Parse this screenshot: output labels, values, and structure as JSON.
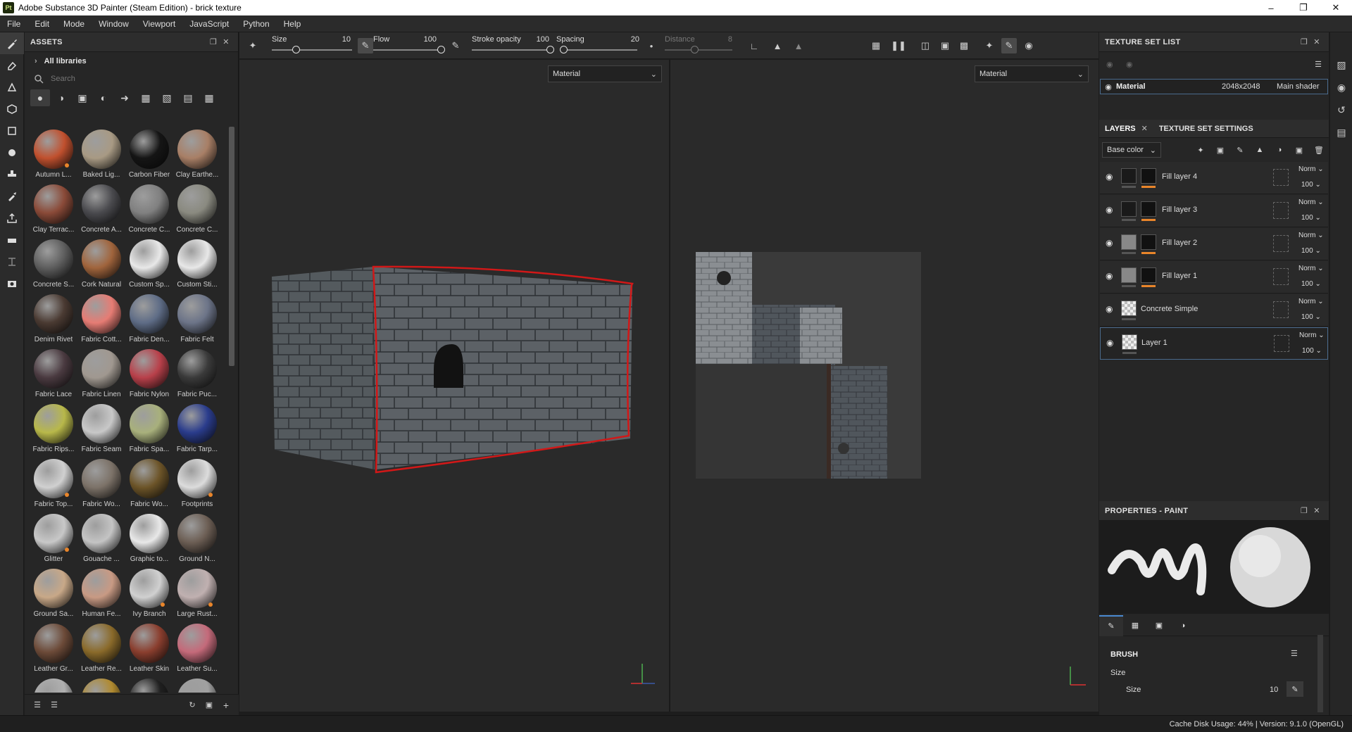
{
  "window": {
    "title": "Adobe Substance 3D Painter (Steam Edition) - brick texture",
    "app_icon": "Pt"
  },
  "menu": [
    "File",
    "Edit",
    "Mode",
    "Window",
    "Viewport",
    "JavaScript",
    "Python",
    "Help"
  ],
  "assets": {
    "title": "ASSETS",
    "library": "All libraries",
    "search_placeholder": "Search",
    "items": [
      {
        "label": "Autumn L...",
        "color": "#c0502e",
        "badge": true
      },
      {
        "label": "Baked Lig...",
        "color": "#a89a84",
        "badge": false
      },
      {
        "label": "Carbon Fiber",
        "color": "#151515",
        "badge": false
      },
      {
        "label": "Clay Earthe...",
        "color": "#a87f66",
        "badge": false
      },
      {
        "label": "Clay Terrac...",
        "color": "#8a4a38",
        "badge": false
      },
      {
        "label": "Concrete A...",
        "color": "#4a4a4e",
        "badge": false
      },
      {
        "label": "Concrete C...",
        "color": "#808080",
        "badge": false
      },
      {
        "label": "Concrete C...",
        "color": "#8a8a80",
        "badge": false
      },
      {
        "label": "Concrete S...",
        "color": "#5e5e5e",
        "badge": false
      },
      {
        "label": "Cork Natural",
        "color": "#a0643c",
        "badge": false
      },
      {
        "label": "Custom Sp...",
        "color": "#e8e8e8",
        "badge": false
      },
      {
        "label": "Custom Sti...",
        "color": "#e8e8e8",
        "badge": false
      },
      {
        "label": "Denim Rivet",
        "color": "#4a3a32",
        "badge": false
      },
      {
        "label": "Fabric Cott...",
        "color": "#e67c74",
        "badge": false
      },
      {
        "label": "Fabric Den...",
        "color": "#5e6c86",
        "badge": false
      },
      {
        "label": "Fabric Felt",
        "color": "#6c7488",
        "badge": false
      },
      {
        "label": "Fabric Lace",
        "color": "#4a3a40",
        "badge": false
      },
      {
        "label": "Fabric Linen",
        "color": "#a09890",
        "badge": false
      },
      {
        "label": "Fabric Nylon",
        "color": "#b8404a",
        "badge": false
      },
      {
        "label": "Fabric Puc...",
        "color": "#3a3a3a",
        "badge": false
      },
      {
        "label": "Fabric Rips...",
        "color": "#b8b84a",
        "badge": false
      },
      {
        "label": "Fabric Seam",
        "color": "#c8c8c8",
        "badge": false
      },
      {
        "label": "Fabric Spa...",
        "color": "#a8b07c",
        "badge": false
      },
      {
        "label": "Fabric Tarp...",
        "color": "#2a3c8c",
        "badge": false
      },
      {
        "label": "Fabric Top...",
        "color": "#d0d0d0",
        "badge": true
      },
      {
        "label": "Fabric Wo...",
        "color": "#7c7268",
        "badge": false
      },
      {
        "label": "Fabric Wo...",
        "color": "#6c5428",
        "badge": false
      },
      {
        "label": "Footprints",
        "color": "#dcdcdc",
        "badge": true
      },
      {
        "label": "Glitter",
        "color": "#c8c8c8",
        "badge": true
      },
      {
        "label": "Gouache ...",
        "color": "#c4c4c4",
        "badge": false
      },
      {
        "label": "Graphic to...",
        "color": "#e8e8e8",
        "badge": false
      },
      {
        "label": "Ground N...",
        "color": "#6c5e54",
        "badge": false
      },
      {
        "label": "Ground Sa...",
        "color": "#c8a888",
        "badge": false
      },
      {
        "label": "Human Fe...",
        "color": "#c89a84",
        "badge": false
      },
      {
        "label": "Ivy Branch",
        "color": "#d0d0d0",
        "badge": true
      },
      {
        "label": "Large Rust...",
        "color": "#c0b0b0",
        "badge": true
      },
      {
        "label": "Leather Gr...",
        "color": "#6c4a38",
        "badge": false
      },
      {
        "label": "Leather Re...",
        "color": "#8a6a2a",
        "badge": false
      },
      {
        "label": "Leather Skin",
        "color": "#8a3e2e",
        "badge": false
      },
      {
        "label": "Leather Su...",
        "color": "#c46a7a",
        "badge": false
      },
      {
        "label": "",
        "color": "#b0b0b0",
        "badge": false
      },
      {
        "label": "",
        "color": "#b08a30",
        "badge": false
      },
      {
        "label": "",
        "color": "#202020",
        "badge": false
      },
      {
        "label": "",
        "color": "#a0a0a0",
        "badge": false
      }
    ]
  },
  "toolbar": {
    "size_label": "Size",
    "size_value": "10",
    "flow_label": "Flow",
    "flow_value": "100",
    "stroke_label": "Stroke opacity",
    "stroke_value": "100",
    "spacing_label": "Spacing",
    "spacing_value": "20",
    "distance_label": "Distance",
    "distance_value": "8"
  },
  "viewport3d": {
    "material_select": "Material"
  },
  "viewport2d": {
    "material_select": "Material"
  },
  "texture_set": {
    "title": "TEXTURE SET LIST",
    "name": "Material",
    "resolution": "2048x2048",
    "shader": "Main shader"
  },
  "layers_panel": {
    "tab_layers": "LAYERS",
    "tab_settings": "TEXTURE SET SETTINGS",
    "channel": "Base color",
    "layers": [
      {
        "name": "Fill layer 4",
        "blend": "Norm",
        "opacity": "100"
      },
      {
        "name": "Fill layer 3",
        "blend": "Norm",
        "opacity": "100"
      },
      {
        "name": "Fill layer 2",
        "blend": "Norm",
        "opacity": "100"
      },
      {
        "name": "Fill layer 1",
        "blend": "Norm",
        "opacity": "100"
      },
      {
        "name": "Concrete Simple",
        "blend": "Norm",
        "opacity": "100"
      },
      {
        "name": "Layer 1",
        "blend": "Norm",
        "opacity": "100"
      }
    ]
  },
  "properties": {
    "title": "PROPERTIES - PAINT",
    "section": "BRUSH",
    "size_group": "Size",
    "size_label": "Size",
    "size_value": "10"
  },
  "status": {
    "text": "Cache Disk Usage:   44%  |  Version: 9.1.0 (OpenGL)"
  }
}
